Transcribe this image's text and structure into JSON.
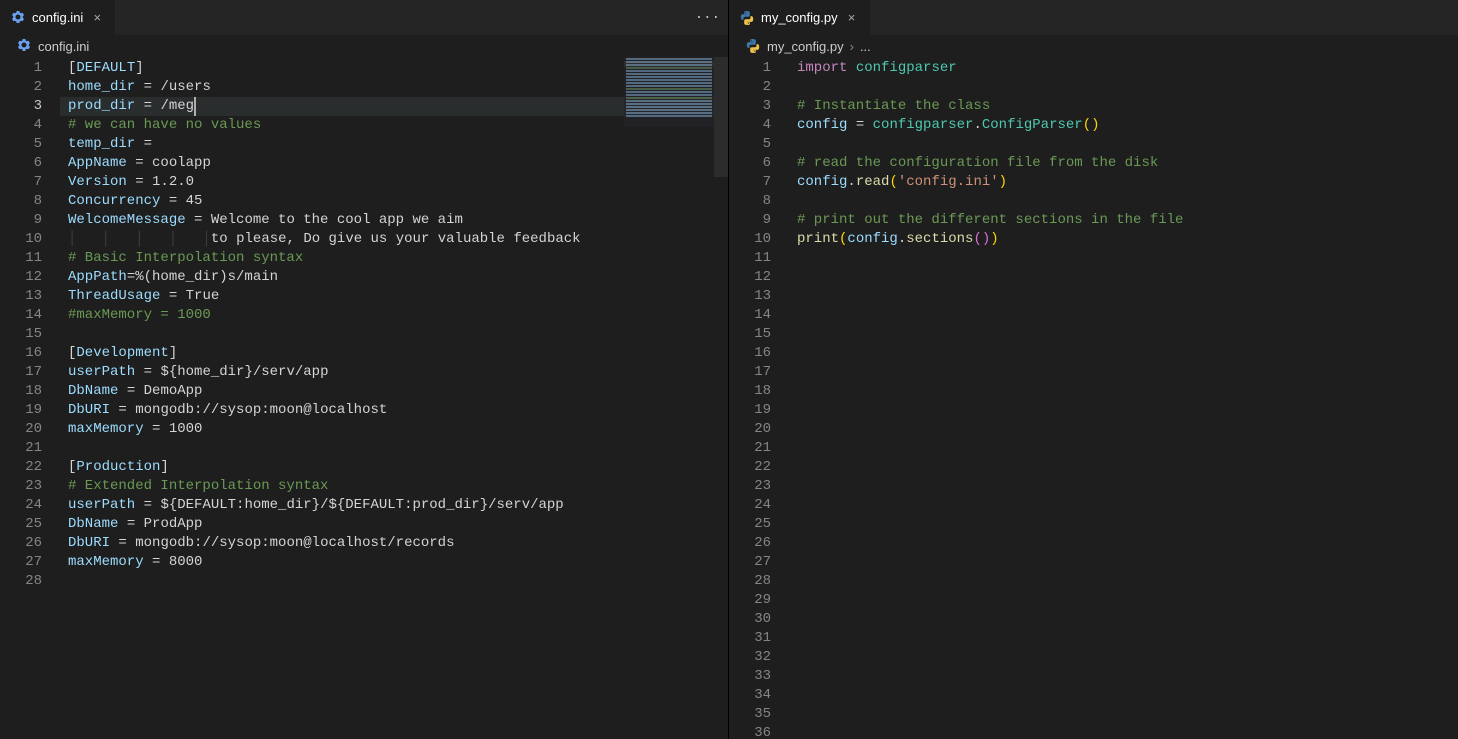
{
  "left": {
    "tab": {
      "filename": "config.ini",
      "closable": true
    },
    "breadcrumb": {
      "filename": "config.ini"
    },
    "activeLine": 3,
    "cursorCh": "/meg",
    "lines": [
      {
        "t": "section",
        "text": "[DEFAULT]"
      },
      {
        "t": "kv",
        "k": "home_dir",
        "v": "/users"
      },
      {
        "t": "kv",
        "k": "prod_dir",
        "v": "/meg"
      },
      {
        "t": "comment",
        "text": "# we can have no values"
      },
      {
        "t": "kv",
        "k": "temp_dir",
        "v": ""
      },
      {
        "t": "kv",
        "k": "AppName",
        "v": "coolapp"
      },
      {
        "t": "kv",
        "k": "Version",
        "v": "1.2.0"
      },
      {
        "t": "kv",
        "k": "Concurrency",
        "v": "45"
      },
      {
        "t": "kv",
        "k": "WelcomeMessage",
        "v": "Welcome to the cool app we aim"
      },
      {
        "t": "cont",
        "indent": 17,
        "v": "to please, Do give us your valuable feedback"
      },
      {
        "t": "comment",
        "text": "# Basic Interpolation syntax"
      },
      {
        "t": "kvraw",
        "k": "AppPath",
        "raw": "=%(home_dir)s/main"
      },
      {
        "t": "kv",
        "k": "ThreadUsage",
        "v": "True"
      },
      {
        "t": "comment",
        "text": "#maxMemory = 1000"
      },
      {
        "t": "blank"
      },
      {
        "t": "section",
        "text": "[Development]"
      },
      {
        "t": "kv",
        "k": "userPath",
        "v": "${home_dir}/serv/app"
      },
      {
        "t": "kv",
        "k": "DbName",
        "v": "DemoApp"
      },
      {
        "t": "kv",
        "k": "DbURI",
        "v": "mongodb://sysop:moon@localhost"
      },
      {
        "t": "kv",
        "k": "maxMemory",
        "v": "1000"
      },
      {
        "t": "blank"
      },
      {
        "t": "section",
        "text": "[Production]"
      },
      {
        "t": "comment",
        "text": "# Extended Interpolation syntax"
      },
      {
        "t": "kv",
        "k": "userPath",
        "v": "${DEFAULT:home_dir}/${DEFAULT:prod_dir}/serv/app"
      },
      {
        "t": "kv",
        "k": "DbName",
        "v": "ProdApp"
      },
      {
        "t": "kv",
        "k": "DbURI",
        "v": "mongodb://sysop:moon@localhost/records"
      },
      {
        "t": "kv",
        "k": "maxMemory",
        "v": "8000"
      },
      {
        "t": "blank"
      }
    ]
  },
  "right": {
    "tab": {
      "filename": "my_config.py",
      "closable": true
    },
    "breadcrumb": {
      "filename": "my_config.py",
      "more": "..."
    },
    "totalLines": 36,
    "lines": [
      {
        "tokens": [
          {
            "c": "c-kw",
            "s": "import"
          },
          {
            "c": "",
            "s": " "
          },
          {
            "c": "c-mod",
            "s": "configparser"
          }
        ]
      },
      {
        "tokens": []
      },
      {
        "tokens": [
          {
            "c": "c-comment",
            "s": "# Instantiate the class"
          }
        ]
      },
      {
        "tokens": [
          {
            "c": "c-ident",
            "s": "config"
          },
          {
            "c": "",
            "s": " "
          },
          {
            "c": "c-op",
            "s": "="
          },
          {
            "c": "",
            "s": " "
          },
          {
            "c": "c-mod",
            "s": "configparser"
          },
          {
            "c": "c-punc",
            "s": "."
          },
          {
            "c": "c-mod",
            "s": "ConfigParser"
          },
          {
            "c": "c-par",
            "s": "()"
          }
        ]
      },
      {
        "tokens": []
      },
      {
        "tokens": [
          {
            "c": "c-comment",
            "s": "# read the configuration file from the disk"
          }
        ]
      },
      {
        "tokens": [
          {
            "c": "c-ident",
            "s": "config"
          },
          {
            "c": "c-punc",
            "s": "."
          },
          {
            "c": "c-fn",
            "s": "read"
          },
          {
            "c": "c-par",
            "s": "("
          },
          {
            "c": "c-str",
            "s": "'config.ini'"
          },
          {
            "c": "c-par",
            "s": ")"
          }
        ]
      },
      {
        "tokens": []
      },
      {
        "tokens": [
          {
            "c": "c-comment",
            "s": "# print out the different sections in the file"
          }
        ]
      },
      {
        "tokens": [
          {
            "c": "c-fn",
            "s": "print"
          },
          {
            "c": "c-par",
            "s": "("
          },
          {
            "c": "c-ident",
            "s": "config"
          },
          {
            "c": "c-punc",
            "s": "."
          },
          {
            "c": "c-fn",
            "s": "sections"
          },
          {
            "c": "c-par2",
            "s": "()"
          },
          {
            "c": "c-par",
            "s": ")"
          }
        ]
      }
    ]
  }
}
